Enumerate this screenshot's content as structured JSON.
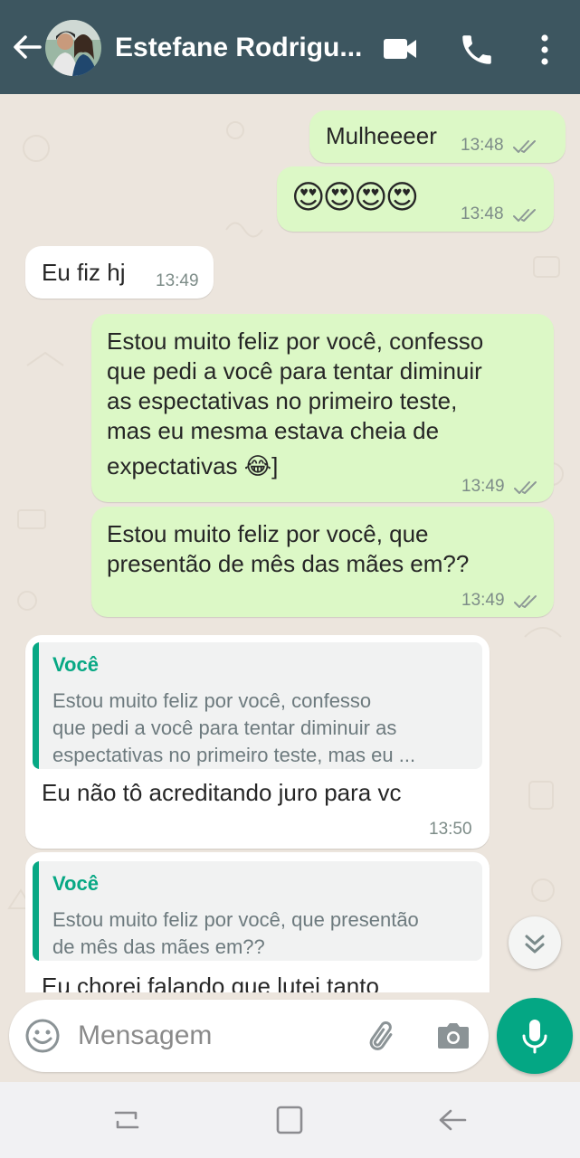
{
  "header": {
    "contact_name": "Estefane Rodrigu...",
    "icons": {
      "back": "arrow-left-icon",
      "avatar": "contact-avatar",
      "video": "video-camera-icon",
      "call": "phone-icon",
      "more": "more-vertical-icon"
    }
  },
  "messages": [
    {
      "direction": "out",
      "text": "Mulheeeer",
      "time": "13:48",
      "status": "read"
    },
    {
      "direction": "out",
      "text": "😍😍😍😍",
      "time": "13:48",
      "status": "read"
    },
    {
      "direction": "in",
      "text": "Eu fiz hj",
      "time": "13:49"
    },
    {
      "direction": "out",
      "lines": [
        "Estou muito feliz por você, confesso",
        "que pedi a você para tentar diminuir",
        "as espectativas no primeiro teste,",
        "mas eu mesma estava cheia de",
        "expectativas 😂]"
      ],
      "time": "13:49",
      "status": "read"
    },
    {
      "direction": "out",
      "lines": [
        "Estou muito feliz por você, que",
        "presentão de mês das mães em??"
      ],
      "time": "13:49",
      "status": "read"
    },
    {
      "direction": "in",
      "quote": {
        "author": "Você",
        "lines": [
          "Estou muito feliz por você, confesso",
          "que pedi a você para tentar diminuir as",
          "espectativas no primeiro teste, mas eu ..."
        ]
      },
      "text": "Eu não tô acreditando juro para vc",
      "time": "13:50"
    },
    {
      "direction": "in",
      "quote": {
        "author": "Você",
        "lines": [
          "Estou muito feliz por você, que presentão",
          "de mês das mães em??"
        ]
      },
      "text": "Eu chorei falando que lutei tanto"
    }
  ],
  "input": {
    "placeholder": "Mensagem",
    "icons": {
      "emoji": "emoji-icon",
      "attach": "paperclip-icon",
      "camera": "camera-icon",
      "mic": "microphone-icon"
    }
  },
  "scroll_down_icon": "chevron-double-down-icon",
  "system_nav": {
    "recent": "recent-apps-icon",
    "home": "home-icon",
    "back": "nav-back-icon"
  },
  "colors": {
    "header": "#3d5660",
    "chat_background": "#ece5dd",
    "outgoing_bubble": "#dcf8c6",
    "incoming_bubble": "#ffffff",
    "accent": "#07a884",
    "mic_button": "#04a784"
  }
}
